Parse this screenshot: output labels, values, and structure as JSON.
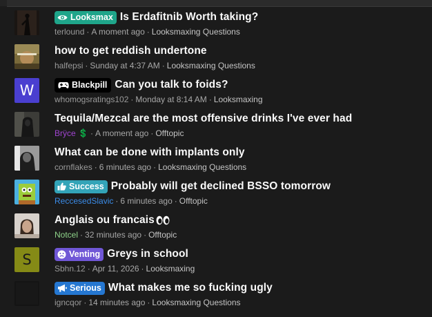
{
  "threads": [
    {
      "avatar": {
        "kind": "image",
        "icon": "silhouette-photo"
      },
      "prefix": {
        "label": "Looksmax",
        "icon": "eye-icon",
        "color": "#1fa58a"
      },
      "title": "Is Erdafitnib Worth taking?",
      "user": "terlound",
      "time": "A moment ago",
      "forum": "Looksmaxing Questions"
    },
    {
      "avatar": {
        "kind": "image",
        "icon": "meme-photo"
      },
      "prefix": null,
      "title": "how to get reddish undertone",
      "user": "halfepsi",
      "time": "Sunday at 4:37 AM",
      "forum": "Looksmaxing Questions"
    },
    {
      "avatar": {
        "kind": "letter",
        "letter": "W",
        "color": "#4a3fd0"
      },
      "prefix": {
        "label": "Blackpill",
        "icon": "gamepad-icon",
        "color": "#000000"
      },
      "title": "Can you talk to foids?",
      "user": "whomogsratings102",
      "time": "Monday at 8:14 AM",
      "forum": "Looksmaxing"
    },
    {
      "avatar": {
        "kind": "image",
        "icon": "hooded-figure-photo"
      },
      "prefix": null,
      "title": "Tequila/Mezcal are the most offensive drinks I've ever had",
      "user": "Brÿce 💲",
      "time": "A moment ago",
      "forum": "Offtopic"
    },
    {
      "avatar": {
        "kind": "image",
        "icon": "portrait-photo"
      },
      "prefix": null,
      "title": "What can be done with implants only",
      "user": "cornflakes",
      "time": "6 minutes ago",
      "forum": "Looksmaxing Questions"
    },
    {
      "avatar": {
        "kind": "image",
        "icon": "sponge-photo"
      },
      "prefix": {
        "label": "Success",
        "icon": "thumbs-up-icon",
        "color": "#33a4b8"
      },
      "title": "Probably will get declined BSSO tomorrow",
      "user": "ReccesedSlavic",
      "time": "6 minutes ago",
      "forum": "Offtopic"
    },
    {
      "avatar": {
        "kind": "image",
        "icon": "face-photo"
      },
      "prefix": null,
      "title": "Anglais ou francais",
      "title_emoji": "eyes-emoji",
      "user": "Notcel",
      "time": "32 minutes ago",
      "forum": "Offtopic"
    },
    {
      "avatar": {
        "kind": "letter",
        "letter": "S",
        "color": "#858a16"
      },
      "prefix": {
        "label": "Venting",
        "icon": "sad-face-icon",
        "color": "#7057d6"
      },
      "title": "Greys in school",
      "user": "Sbhn.12",
      "time": "Apr 11, 2026",
      "forum": "Looksmaxing"
    },
    {
      "avatar": {
        "kind": "image",
        "icon": "dark-photo"
      },
      "prefix": {
        "label": "Serious",
        "icon": "megaphone-icon",
        "color": "#2577d1"
      },
      "title": "What makes me so fucking ugly",
      "user": "igncqor",
      "time": "14 minutes ago",
      "forum": "Looksmaxing Questions"
    }
  ]
}
